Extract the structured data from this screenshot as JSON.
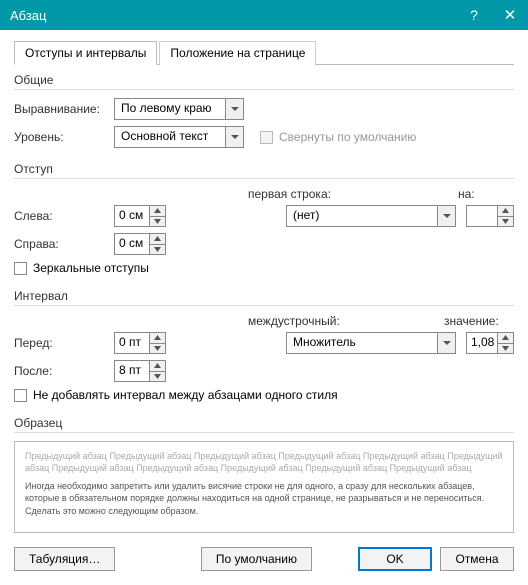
{
  "titlebar": {
    "title": "Абзац",
    "help": "?",
    "close": "✕"
  },
  "tabs": {
    "t1": "Отступы и интервалы",
    "t2": "Положение на странице"
  },
  "groups": {
    "general": "Общие",
    "indent": "Отступ",
    "spacing": "Интервал",
    "preview": "Образец"
  },
  "general": {
    "align_label": "Выравнивание:",
    "align_value": "По левому краю",
    "level_label": "Уровень:",
    "level_value": "Основной текст",
    "collapsed_label": "Свернуты по умолчанию"
  },
  "indent": {
    "left_label": "Слева:",
    "left_value": "0 см",
    "right_label": "Справа:",
    "right_value": "0 см",
    "firstline_label": "первая строка:",
    "firstline_value": "(нет)",
    "by_label": "на:",
    "by_value": "",
    "mirror_label": "Зеркальные отступы"
  },
  "spacing": {
    "before_label": "Перед:",
    "before_value": "0 пт",
    "after_label": "После:",
    "after_value": "8 пт",
    "linespacing_label": "междустрочный:",
    "linespacing_value": "Множитель",
    "at_label": "значение:",
    "at_value": "1,08",
    "noadd_label": "Не добавлять интервал между абзацами одного стиля"
  },
  "preview": {
    "gray": "Предыдущий абзац Предыдущий абзац Предыдущий абзац Предыдущий абзац Предыдущий абзац Предыдущий абзац Предыдущий абзац Предыдущий абзац Предыдущий абзац Предыдущий абзац Предыдущий абзац",
    "body": "Иногда необходимо запретить или удалить висячие строки не для одного, а сразу для нескольких абзацев, которые в обязательном порядке должны находиться на одной странице, не разрываться и не переноситься. Сделать это можно следующим образом."
  },
  "footer": {
    "tabs_btn": "Табуляция…",
    "default_btn": "По умолчанию",
    "ok": "OK",
    "cancel": "Отмена"
  }
}
